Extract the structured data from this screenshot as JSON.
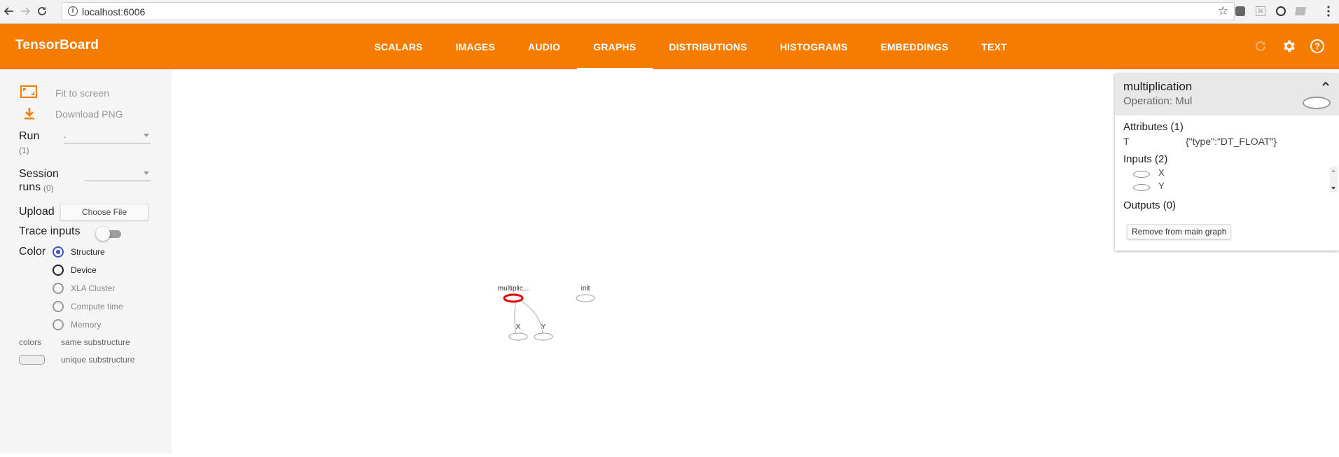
{
  "browser": {
    "url": "localhost:6006"
  },
  "header": {
    "title": "TensorBoard",
    "tabs": [
      {
        "label": "SCALARS"
      },
      {
        "label": "IMAGES"
      },
      {
        "label": "AUDIO"
      },
      {
        "label": "GRAPHS",
        "active": true
      },
      {
        "label": "DISTRIBUTIONS"
      },
      {
        "label": "HISTOGRAMS"
      },
      {
        "label": "EMBEDDINGS"
      },
      {
        "label": "TEXT"
      }
    ],
    "accent": "#f57c00"
  },
  "sidebar": {
    "fit_to_screen": "Fit to screen",
    "download_png": "Download PNG",
    "run_label": "Run",
    "run_count": "(1)",
    "run_value": ".",
    "session_label_1": "Session",
    "session_label_2": "runs",
    "session_count": "(0)",
    "session_value": "",
    "upload_label": "Upload",
    "choose_file": "Choose File",
    "trace_inputs": "Trace inputs",
    "color_label": "Color",
    "color_options": [
      {
        "label": "Structure",
        "checked": true
      },
      {
        "label": "Device"
      },
      {
        "label": "XLA Cluster"
      },
      {
        "label": "Compute time"
      },
      {
        "label": "Memory"
      }
    ],
    "legend_colors": "colors",
    "legend_same": "same substructure",
    "legend_unique": "unique substructure"
  },
  "graph": {
    "nodes": {
      "multiplication": "multiplic...",
      "init": "init",
      "x": "X",
      "y": "Y"
    }
  },
  "card": {
    "title": "multiplication",
    "operation": "Operation: Mul",
    "attributes_header": "Attributes (1)",
    "attr_key": "T",
    "attr_value": "{\"type\":\"DT_FLOAT\"}",
    "inputs_header": "Inputs (2)",
    "inputs": [
      "X",
      "Y"
    ],
    "outputs_header": "Outputs (0)",
    "remove_button": "Remove from main graph"
  }
}
